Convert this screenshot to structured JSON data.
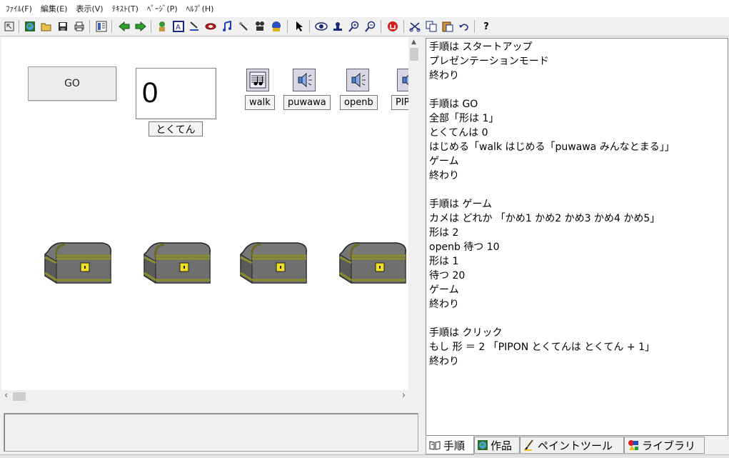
{
  "menu": [
    {
      "label": "ﾌｧｲﾙ(F)"
    },
    {
      "label": "編集(E)"
    },
    {
      "label": "表示(V)"
    },
    {
      "label": "ﾃｷｽﾄ(T)"
    },
    {
      "label": "ﾍﾟｰｼﾞ(P)"
    },
    {
      "label": "ﾍﾙﾌﾟ(H)"
    }
  ],
  "toolbar": {
    "icons": [
      "cursor-return-icon",
      "globe-icon",
      "open-folder-icon",
      "save-icon",
      "print-icon",
      "page-view-icon",
      "back-arrow-icon",
      "forward-arrow-icon",
      "character-icon",
      "text-box-icon",
      "paint-icon",
      "button-icon",
      "music-note-icon",
      "magic-wand-icon",
      "movie-icon",
      "globe-link-icon",
      "pointer-icon",
      "eye-icon",
      "stamp-icon",
      "zoom-in-icon",
      "zoom-out-icon",
      "stop-icon",
      "cut-icon",
      "copy-icon",
      "paste-icon",
      "undo-icon",
      "help-icon"
    ],
    "help_label": "?"
  },
  "stage": {
    "go_button": "GO",
    "score_value": "0",
    "score_label": "とくてん",
    "sounds": [
      {
        "name": "walk",
        "icon": "music-score-icon"
      },
      {
        "name": "puwawa",
        "icon": "speaker-icon"
      },
      {
        "name": "openb",
        "icon": "speaker-icon"
      },
      {
        "name": "PIPON",
        "icon": "speaker-icon"
      }
    ],
    "chests": 4
  },
  "script": [
    "手順は スタートアップ",
    "プレゼンテーションモード",
    "終わり",
    "",
    "手順は GO",
    "全部「形は 1」",
    "とくてんは 0",
    "はじめる「walk はじめる「puwawa みんなとまる」」",
    "ゲーム",
    "終わり",
    "",
    "手順は ゲーム",
    "カメは どれか 「かめ1 かめ2 かめ3 かめ4 かめ5」",
    "形は 2",
    "openb 待つ 10",
    "形は 1",
    "待つ 20",
    "ゲーム",
    "終わり",
    "",
    "手順は クリック",
    "もし 形 ＝ 2 「PIPON とくてんは とくてん + 1」",
    "終わり"
  ],
  "tabs": [
    {
      "label": "手順",
      "icon": "book-icon",
      "active": true
    },
    {
      "label": "作品",
      "icon": "globe-icon",
      "active": false
    },
    {
      "label": "ペイントツール",
      "icon": "brush-icon",
      "active": false
    },
    {
      "label": "ライブラリ",
      "icon": "shapes-icon",
      "active": false
    }
  ]
}
